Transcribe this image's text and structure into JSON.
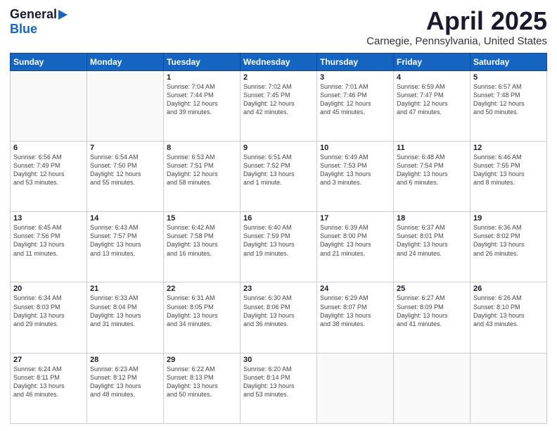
{
  "header": {
    "logo_line1": "General",
    "logo_line2": "Blue",
    "main_title": "April 2025",
    "subtitle": "Carnegie, Pennsylvania, United States"
  },
  "days_of_week": [
    "Sunday",
    "Monday",
    "Tuesday",
    "Wednesday",
    "Thursday",
    "Friday",
    "Saturday"
  ],
  "weeks": [
    [
      {
        "day": "",
        "detail": ""
      },
      {
        "day": "",
        "detail": ""
      },
      {
        "day": "1",
        "detail": "Sunrise: 7:04 AM\nSunset: 7:44 PM\nDaylight: 12 hours\nand 39 minutes."
      },
      {
        "day": "2",
        "detail": "Sunrise: 7:02 AM\nSunset: 7:45 PM\nDaylight: 12 hours\nand 42 minutes."
      },
      {
        "day": "3",
        "detail": "Sunrise: 7:01 AM\nSunset: 7:46 PM\nDaylight: 12 hours\nand 45 minutes."
      },
      {
        "day": "4",
        "detail": "Sunrise: 6:59 AM\nSunset: 7:47 PM\nDaylight: 12 hours\nand 47 minutes."
      },
      {
        "day": "5",
        "detail": "Sunrise: 6:57 AM\nSunset: 7:48 PM\nDaylight: 12 hours\nand 50 minutes."
      }
    ],
    [
      {
        "day": "6",
        "detail": "Sunrise: 6:56 AM\nSunset: 7:49 PM\nDaylight: 12 hours\nand 53 minutes."
      },
      {
        "day": "7",
        "detail": "Sunrise: 6:54 AM\nSunset: 7:50 PM\nDaylight: 12 hours\nand 55 minutes."
      },
      {
        "day": "8",
        "detail": "Sunrise: 6:53 AM\nSunset: 7:51 PM\nDaylight: 12 hours\nand 58 minutes."
      },
      {
        "day": "9",
        "detail": "Sunrise: 6:51 AM\nSunset: 7:52 PM\nDaylight: 13 hours\nand 1 minute."
      },
      {
        "day": "10",
        "detail": "Sunrise: 6:49 AM\nSunset: 7:53 PM\nDaylight: 13 hours\nand 3 minutes."
      },
      {
        "day": "11",
        "detail": "Sunrise: 6:48 AM\nSunset: 7:54 PM\nDaylight: 13 hours\nand 6 minutes."
      },
      {
        "day": "12",
        "detail": "Sunrise: 6:46 AM\nSunset: 7:55 PM\nDaylight: 13 hours\nand 8 minutes."
      }
    ],
    [
      {
        "day": "13",
        "detail": "Sunrise: 6:45 AM\nSunset: 7:56 PM\nDaylight: 13 hours\nand 11 minutes."
      },
      {
        "day": "14",
        "detail": "Sunrise: 6:43 AM\nSunset: 7:57 PM\nDaylight: 13 hours\nand 13 minutes."
      },
      {
        "day": "15",
        "detail": "Sunrise: 6:42 AM\nSunset: 7:58 PM\nDaylight: 13 hours\nand 16 minutes."
      },
      {
        "day": "16",
        "detail": "Sunrise: 6:40 AM\nSunset: 7:59 PM\nDaylight: 13 hours\nand 19 minutes."
      },
      {
        "day": "17",
        "detail": "Sunrise: 6:39 AM\nSunset: 8:00 PM\nDaylight: 13 hours\nand 21 minutes."
      },
      {
        "day": "18",
        "detail": "Sunrise: 6:37 AM\nSunset: 8:01 PM\nDaylight: 13 hours\nand 24 minutes."
      },
      {
        "day": "19",
        "detail": "Sunrise: 6:36 AM\nSunset: 8:02 PM\nDaylight: 13 hours\nand 26 minutes."
      }
    ],
    [
      {
        "day": "20",
        "detail": "Sunrise: 6:34 AM\nSunset: 8:03 PM\nDaylight: 13 hours\nand 29 minutes."
      },
      {
        "day": "21",
        "detail": "Sunrise: 6:33 AM\nSunset: 8:04 PM\nDaylight: 13 hours\nand 31 minutes."
      },
      {
        "day": "22",
        "detail": "Sunrise: 6:31 AM\nSunset: 8:05 PM\nDaylight: 13 hours\nand 34 minutes."
      },
      {
        "day": "23",
        "detail": "Sunrise: 6:30 AM\nSunset: 8:06 PM\nDaylight: 13 hours\nand 36 minutes."
      },
      {
        "day": "24",
        "detail": "Sunrise: 6:29 AM\nSunset: 8:07 PM\nDaylight: 13 hours\nand 38 minutes."
      },
      {
        "day": "25",
        "detail": "Sunrise: 6:27 AM\nSunset: 8:09 PM\nDaylight: 13 hours\nand 41 minutes."
      },
      {
        "day": "26",
        "detail": "Sunrise: 6:26 AM\nSunset: 8:10 PM\nDaylight: 13 hours\nand 43 minutes."
      }
    ],
    [
      {
        "day": "27",
        "detail": "Sunrise: 6:24 AM\nSunset: 8:11 PM\nDaylight: 13 hours\nand 46 minutes."
      },
      {
        "day": "28",
        "detail": "Sunrise: 6:23 AM\nSunset: 8:12 PM\nDaylight: 13 hours\nand 48 minutes."
      },
      {
        "day": "29",
        "detail": "Sunrise: 6:22 AM\nSunset: 8:13 PM\nDaylight: 13 hours\nand 50 minutes."
      },
      {
        "day": "30",
        "detail": "Sunrise: 6:20 AM\nSunset: 8:14 PM\nDaylight: 13 hours\nand 53 minutes."
      },
      {
        "day": "",
        "detail": ""
      },
      {
        "day": "",
        "detail": ""
      },
      {
        "day": "",
        "detail": ""
      }
    ]
  ]
}
